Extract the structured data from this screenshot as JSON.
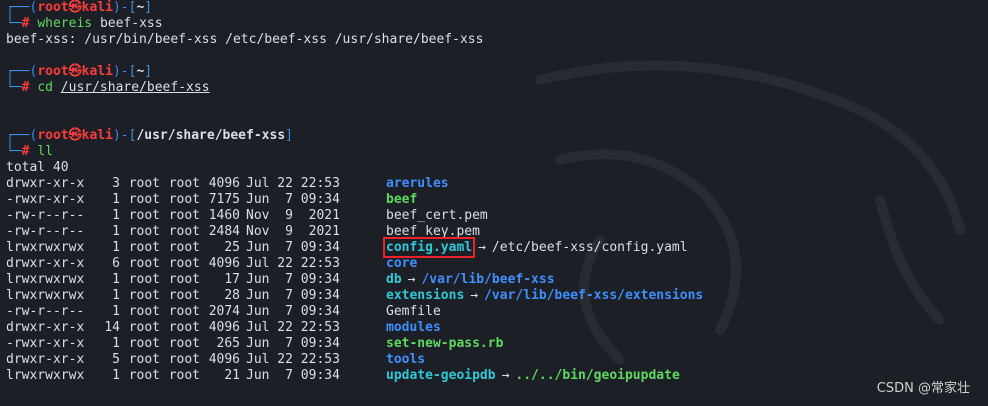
{
  "prompts": [
    {
      "user": "root",
      "host": "kali",
      "cwd": "~",
      "command_name": "whereis",
      "command_args": "beef-xss"
    },
    {
      "user": "root",
      "host": "kali",
      "cwd": "~",
      "command_name": "cd",
      "command_args": "/usr/share/beef-xss"
    },
    {
      "user": "root",
      "host": "kali",
      "cwd": "/usr/share/beef-xss",
      "command_name": "ll",
      "command_args": ""
    }
  ],
  "whereis_output": "beef-xss: /usr/bin/beef-xss /etc/beef-xss /usr/share/beef-xss",
  "listing": {
    "total": "total 40",
    "rows": [
      {
        "perm": "drwxr-xr-x",
        "links": "3",
        "owner": "root",
        "group": "root",
        "size": "4096",
        "date": "Jul 22 22:53",
        "name": "arerules",
        "type": "dir",
        "target": ""
      },
      {
        "perm": "-rwxr-xr-x",
        "links": "1",
        "owner": "root",
        "group": "root",
        "size": "7175",
        "date": "Jun  7 09:34",
        "name": "beef",
        "type": "exec",
        "target": ""
      },
      {
        "perm": "-rw-r--r--",
        "links": "1",
        "owner": "root",
        "group": "root",
        "size": "1460",
        "date": "Nov  9  2021",
        "name": "beef_cert.pem",
        "type": "file",
        "target": ""
      },
      {
        "perm": "-rw-r--r--",
        "links": "1",
        "owner": "root",
        "group": "root",
        "size": "2484",
        "date": "Nov  9  2021",
        "name": "beef_key.pem",
        "type": "file",
        "target": ""
      },
      {
        "perm": "lrwxrwxrwx",
        "links": "1",
        "owner": "root",
        "group": "root",
        "size": "25",
        "date": "Jun  7 09:34",
        "name": "config.yaml",
        "type": "link",
        "target": "/etc/beef-xss/config.yaml",
        "target_type": "file",
        "highlight": true
      },
      {
        "perm": "drwxr-xr-x",
        "links": "6",
        "owner": "root",
        "group": "root",
        "size": "4096",
        "date": "Jul 22 22:53",
        "name": "core",
        "type": "dir",
        "target": ""
      },
      {
        "perm": "lrwxrwxrwx",
        "links": "1",
        "owner": "root",
        "group": "root",
        "size": "17",
        "date": "Jun  7 09:34",
        "name": "db",
        "type": "link",
        "target": "/var/lib/beef-xss",
        "target_type": "dir"
      },
      {
        "perm": "lrwxrwxrwx",
        "links": "1",
        "owner": "root",
        "group": "root",
        "size": "28",
        "date": "Jun  7 09:34",
        "name": "extensions",
        "type": "link",
        "target": "/var/lib/beef-xss/extensions",
        "target_type": "dir"
      },
      {
        "perm": "-rw-r--r--",
        "links": "1",
        "owner": "root",
        "group": "root",
        "size": "2074",
        "date": "Jun  7 09:34",
        "name": "Gemfile",
        "type": "file",
        "target": ""
      },
      {
        "perm": "drwxr-xr-x",
        "links": "14",
        "owner": "root",
        "group": "root",
        "size": "4096",
        "date": "Jul 22 22:53",
        "name": "modules",
        "type": "dir",
        "target": ""
      },
      {
        "perm": "-rwxr-xr-x",
        "links": "1",
        "owner": "root",
        "group": "root",
        "size": "265",
        "date": "Jun  7 09:34",
        "name": "set-new-pass.rb",
        "type": "exec",
        "target": ""
      },
      {
        "perm": "drwxr-xr-x",
        "links": "5",
        "owner": "root",
        "group": "root",
        "size": "4096",
        "date": "Jul 22 22:53",
        "name": "tools",
        "type": "dir",
        "target": ""
      },
      {
        "perm": "lrwxrwxrwx",
        "links": "1",
        "owner": "root",
        "group": "root",
        "size": "21",
        "date": "Jun  7 09:34",
        "name": "update-geoipdb",
        "type": "link",
        "target": "../../bin/geoipupdate",
        "target_type": "exec"
      }
    ]
  },
  "watermark": "CSDN @常家壮",
  "colors": {
    "background": "#1c1f26",
    "prompt_frame": "#3b8eea",
    "user_host": "#ff3c3c",
    "directory": "#3f8fff",
    "symlink": "#30c8d6",
    "executable": "#5fd95f",
    "highlight_box": "#e8232a"
  },
  "icons": {
    "prompt_skull": "skull-icon",
    "link_arrow": "→",
    "background": "kali-dragon-logo"
  }
}
